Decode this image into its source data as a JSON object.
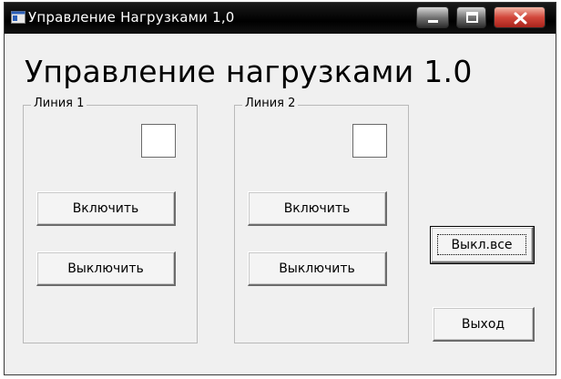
{
  "window": {
    "title": "Управление Нагрузками 1,0",
    "icon": "app-icon"
  },
  "heading": "Управление нагрузками 1.0",
  "lines": [
    {
      "label": "Линия 1",
      "on_label": "Включить",
      "off_label": "Выключить"
    },
    {
      "label": "Линия 2",
      "on_label": "Включить",
      "off_label": "Выключить"
    }
  ],
  "actions": {
    "all_off_label": "Выкл.все",
    "exit_label": "Выход"
  },
  "colors": {
    "titlebar": "#000000",
    "window_bg": "#f0f0f0",
    "close_button": "#d2473b"
  }
}
